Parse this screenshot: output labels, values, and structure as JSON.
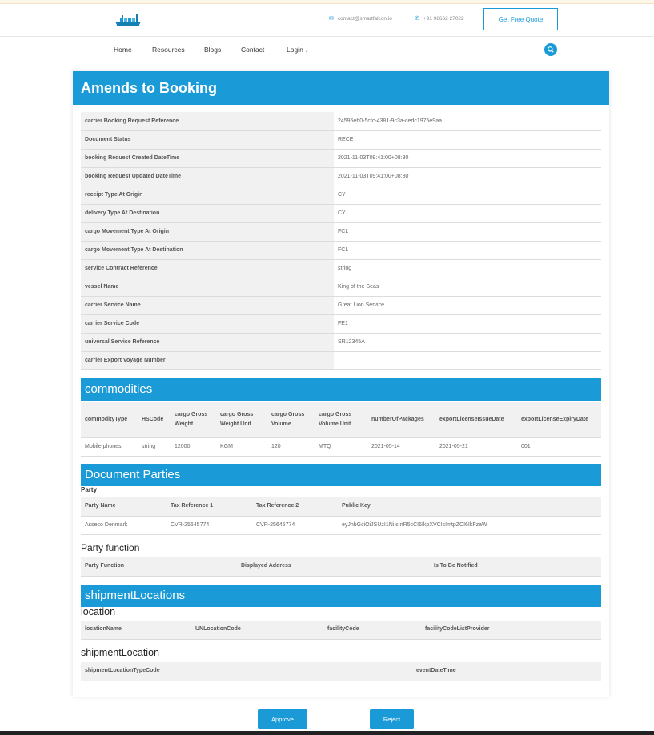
{
  "header": {
    "email": "contact@smartfalcon.io",
    "phone": "+91 98662 27022",
    "quote_label": "Get Free Quote"
  },
  "nav": {
    "items": [
      "Home",
      "Resources",
      "Blogs",
      "Contact",
      "Login"
    ]
  },
  "page": {
    "title": "Amends to Booking"
  },
  "booking_fields": [
    {
      "label": "carrier Booking Request Reference",
      "value": "24595eb0-5cfc-4381-9c3a-cedc1975e9aa"
    },
    {
      "label": "Document Status",
      "value": "RECE"
    },
    {
      "label": "booking Request Created DateTime",
      "value": "2021-11-03T09:41:00+08:30"
    },
    {
      "label": "booking Request Updated DateTime",
      "value": "2021-11-03T09:41:00+08:30"
    },
    {
      "label": "receipt Type At Origin",
      "value": "CY"
    },
    {
      "label": "delivery Type At Destination",
      "value": "CY"
    },
    {
      "label": "cargo Movement Type At Origin",
      "value": "FCL"
    },
    {
      "label": "cargo Movement Type At Destination",
      "value": "FCL"
    },
    {
      "label": "service Contract Reference",
      "value": "string"
    },
    {
      "label": "vessel Name",
      "value": "King of the Seas"
    },
    {
      "label": "carrier Service Name",
      "value": "Great Lion Service"
    },
    {
      "label": "carrier Service Code",
      "value": "FE1"
    },
    {
      "label": "universal Service Reference",
      "value": "SR12345A"
    },
    {
      "label": "carrier Export Voyage Number",
      "value": ""
    }
  ],
  "commodities": {
    "title": "commodities",
    "headers": [
      "commodityType",
      "HSCode",
      "cargo Gross Weight",
      "cargo Gross Weight Unit",
      "cargo Gross Volume",
      "cargo Gross Volume Unit",
      "numberOfPackages",
      "exportLicenseIssueDate",
      "exportLicenseExpiryDate"
    ],
    "rows": [
      [
        "Mobile phones",
        "string",
        "12000",
        "KGM",
        "120",
        "MTQ",
        "2021-05-14",
        "2021-05-21",
        "001"
      ]
    ]
  },
  "document_parties": {
    "title": "Document Parties",
    "party_label": "Party",
    "party_headers": [
      "Party Name",
      "Tax Reference 1",
      "Tax Reference 2",
      "Public Key"
    ],
    "party_rows": [
      [
        "Asseco Denmark",
        "CVR-25645774",
        "CVR-25645774",
        "eyJhbGciOiJSUzI1NiIsInR5cCI6IkpXVCIsImtpZCI6IkFzaW"
      ]
    ],
    "function_label": "Party function",
    "function_headers": [
      "Party Function",
      "Displayed Address",
      "Is To Be Notified"
    ]
  },
  "shipment_locations": {
    "title": "shipmentLocations",
    "location_label": "location",
    "location_headers": [
      "locationName",
      "UNLocationCode",
      "facilityCode",
      "facilityCodeListProvider"
    ],
    "shipment_location_label": "shipmentLocation",
    "shipment_location_headers": [
      "shipmentLocationTypeCode",
      "eventDateTime"
    ]
  },
  "actions": {
    "approve_label": "Approve",
    "reject_label": "Reject"
  },
  "colors": {
    "accent": "#1a9ad6"
  }
}
